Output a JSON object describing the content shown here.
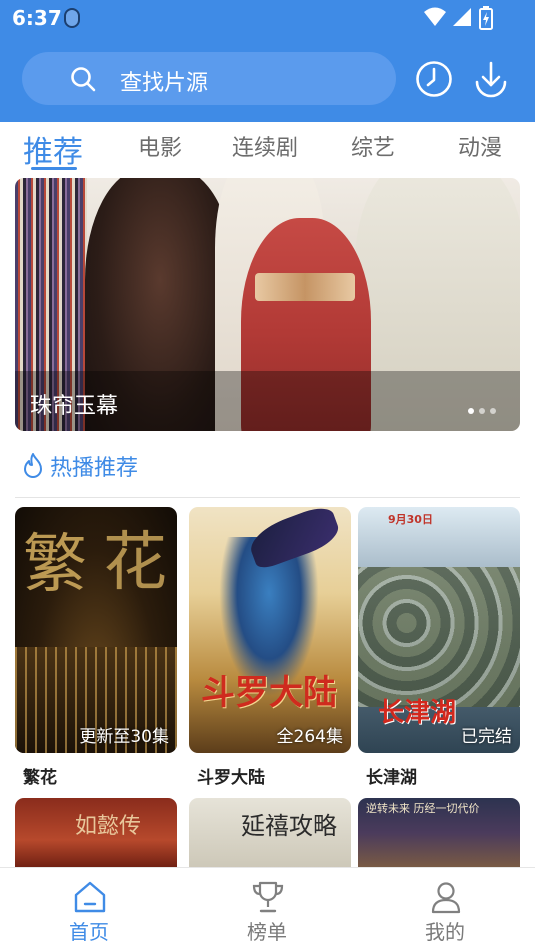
{
  "status_bar": {
    "time": "6:37"
  },
  "search": {
    "placeholder": "查找片源"
  },
  "icons": {
    "search": "search-icon",
    "history": "clock-icon",
    "download": "download-icon",
    "flame": "flame-icon",
    "home": "home-icon",
    "ranking": "trophy-icon",
    "profile": "person-icon"
  },
  "tabs": [
    {
      "label": "推荐",
      "active": true
    },
    {
      "label": "电影",
      "active": false
    },
    {
      "label": "连续剧",
      "active": false
    },
    {
      "label": "综艺",
      "active": false
    },
    {
      "label": "动漫",
      "active": false
    }
  ],
  "banner": {
    "title": "珠帘玉幕",
    "slide_count": 3,
    "active_slide": 1
  },
  "section": {
    "title": "热播推荐"
  },
  "cards": [
    {
      "title": "繁花",
      "badge": "更新至30集",
      "poster_text": [
        "繁",
        "花"
      ]
    },
    {
      "title": "斗罗大陆",
      "badge": "全264集",
      "poster_text": [
        "斗罗大陆"
      ]
    },
    {
      "title": "长津湖",
      "badge": "已完结",
      "poster_text": [
        "9月30日",
        "长津湖"
      ]
    }
  ],
  "row2": [
    {
      "poster_text": "如懿传"
    },
    {
      "poster_text": "延禧攻略"
    },
    {
      "poster_text": "逆转未来  历经一切代价"
    }
  ],
  "bottom_nav": [
    {
      "label": "首页",
      "active": true
    },
    {
      "label": "榜单",
      "active": false
    },
    {
      "label": "我的",
      "active": false
    }
  ],
  "colors": {
    "accent": "#3f8be6",
    "header_bg": "#3f8be6",
    "search_bg": "#5b9bed"
  }
}
